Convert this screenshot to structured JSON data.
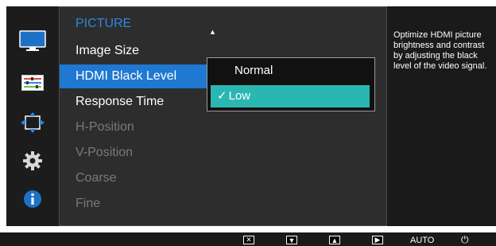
{
  "colors": {
    "osd_bg": "#222222",
    "accent_blue": "#1f78d1",
    "title_blue": "#2f86e0",
    "selection_teal": "#2bb7b1",
    "dim_text": "#7a7a7a"
  },
  "sidebar": {
    "icons": [
      {
        "name": "monitor-picture-icon",
        "active": true
      },
      {
        "name": "color-settings-icon",
        "active": false
      },
      {
        "name": "size-position-icon",
        "active": false
      },
      {
        "name": "setup-gear-icon",
        "active": false
      },
      {
        "name": "information-icon",
        "active": false
      }
    ]
  },
  "menu": {
    "title": "PICTURE",
    "items": [
      {
        "label": "Image Size",
        "state": "normal"
      },
      {
        "label": "HDMI Black Level",
        "state": "selected"
      },
      {
        "label": "Response Time",
        "state": "normal"
      },
      {
        "label": "H-Position",
        "state": "disabled"
      },
      {
        "label": "V-Position",
        "state": "disabled"
      },
      {
        "label": "Coarse",
        "state": "disabled"
      },
      {
        "label": "Fine",
        "state": "disabled"
      }
    ],
    "scroll_up_icon": "up-triangle"
  },
  "submenu": {
    "options": [
      {
        "label": "Normal",
        "selected": false
      },
      {
        "label": "Low",
        "selected": true
      }
    ],
    "check_glyph": "✓"
  },
  "description": {
    "text": "Optimize HDMI picture\nbrightness and contrast\nby adjusting the black\nlevel of the video signal."
  },
  "bottom_bar": {
    "close_glyph": "✕",
    "down_glyph": "▼",
    "up_glyph": "▲",
    "enter_glyph": "▶",
    "auto_label": "AUTO",
    "power_glyph": "⏻"
  }
}
